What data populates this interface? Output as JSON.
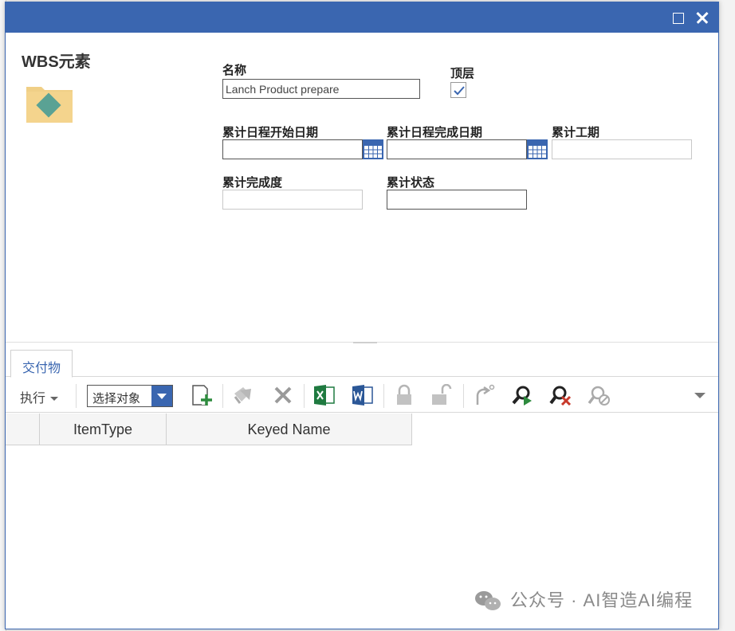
{
  "window": {
    "title_buttons": [
      "maximize-icon",
      "close-icon"
    ],
    "accent_color": "#3a66b0"
  },
  "form": {
    "item_title": "WBS元素",
    "name_label": "名称",
    "name_value": "Lanch Product prepare",
    "top_level_label": "顶层",
    "top_level_checked": true,
    "cum_start_label": "累计日程开始日期",
    "cum_start_value": "",
    "cum_finish_label": "累计日程完成日期",
    "cum_finish_value": "",
    "cum_duration_label": "累计工期",
    "cum_duration_value": "",
    "cum_complete_label": "累计完成度",
    "cum_complete_value": "",
    "cum_status_label": "累计状态",
    "cum_status_value": ""
  },
  "relationship": {
    "tab_label": "交付物",
    "execute_label": "执行",
    "select_placeholder": "选择对象",
    "toolbar_icons": [
      "new-item-icon",
      "pick-item-icon",
      "delete-icon",
      "excel-export-icon",
      "word-export-icon",
      "lock-icon",
      "unlock-icon",
      "promote-icon",
      "search-run-icon",
      "search-clear-icon",
      "search-disabled-icon"
    ],
    "columns": [
      "ItemType",
      "Keyed Name"
    ]
  },
  "watermark": "公众号 · AI智造AI编程"
}
